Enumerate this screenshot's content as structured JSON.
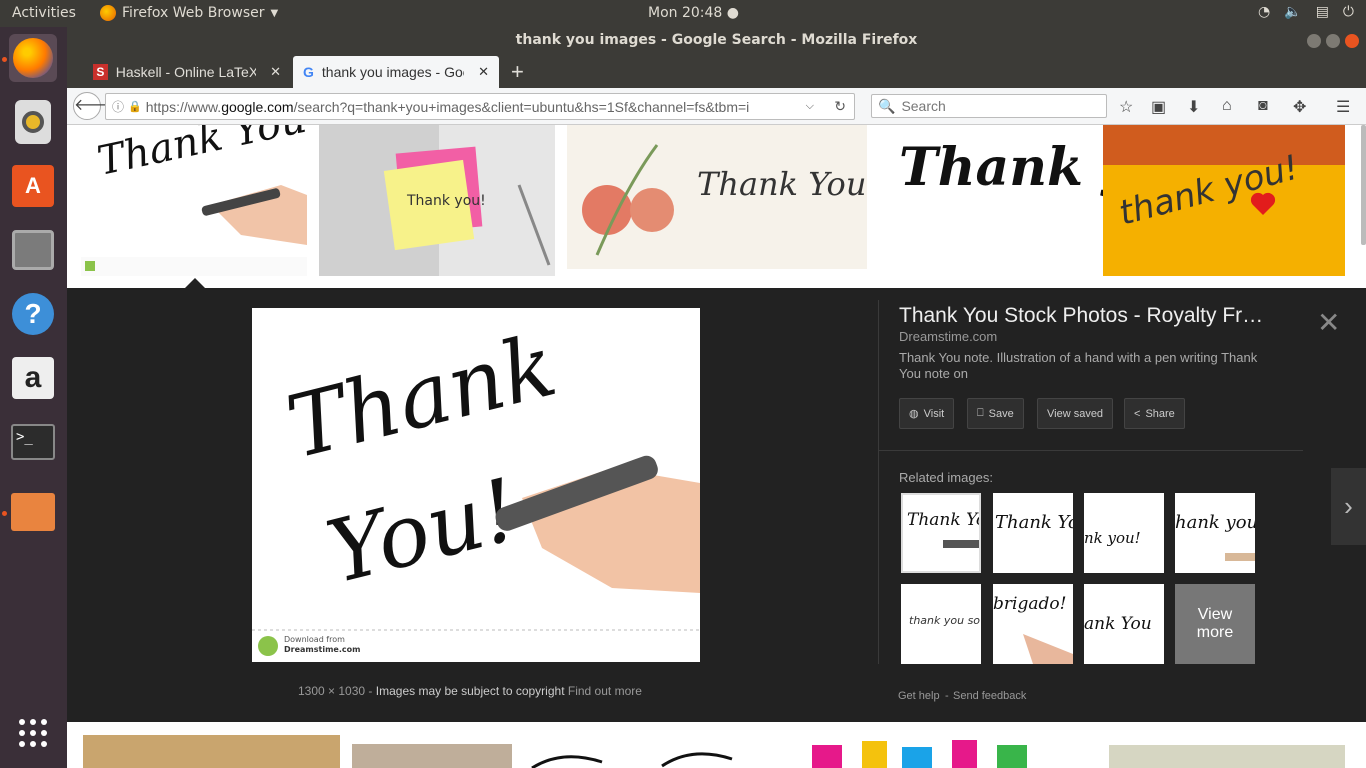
{
  "topbar": {
    "activities": "Activities",
    "app_name": "Firefox Web Browser",
    "clock": "Mon 20:48"
  },
  "window": {
    "title": "thank you images - Google Search - Mozilla Firefox"
  },
  "tabs": [
    {
      "label": "Haskell - Online LaTeX E",
      "favicon": "S"
    },
    {
      "label": "thank you images - Goo",
      "favicon": "G"
    }
  ],
  "navbar": {
    "url_prefix": "https://www.",
    "url_domain": "google.com",
    "url_rest": "/search?q=thank+you+images&client=ubuntu&hs=1Sf&channel=fs&tbm=i",
    "search_placeholder": "Search"
  },
  "grid_top": [
    {
      "text": "Thank You!"
    },
    {
      "text": "Thank you!"
    },
    {
      "text": "Thank You"
    },
    {
      "text": "Thank you"
    },
    {
      "text": "thank you!"
    }
  ],
  "preview": {
    "image_text_1": "Thank",
    "image_text_2": "You!",
    "watermark_line1": "Download from",
    "watermark_line2": "Dreamstime.com",
    "size": "1300 × 1030",
    "separator": "-",
    "copyright": "Images may be subject to copyright",
    "find_more": "Find out more",
    "title": "Thank You Stock Photos - Royalty Fr…",
    "site": "Dreamstime.com",
    "description": "Thank You note. Illustration of a hand with a pen writing Thank You note on",
    "buttons": {
      "visit": "Visit",
      "save": "Save",
      "view_saved": "View saved",
      "share": "Share"
    },
    "related_title": "Related images:",
    "related": [
      {
        "text": "Thank You!"
      },
      {
        "text": "Thank You!"
      },
      {
        "text": "nk you!"
      },
      {
        "text": "hank you"
      },
      {
        "text": "thank you so much"
      },
      {
        "text": "brigado!"
      },
      {
        "text": "ank You"
      },
      {
        "text": "View more"
      }
    ],
    "get_help": "Get help",
    "dash": "-",
    "send_feedback": "Send feedback"
  }
}
